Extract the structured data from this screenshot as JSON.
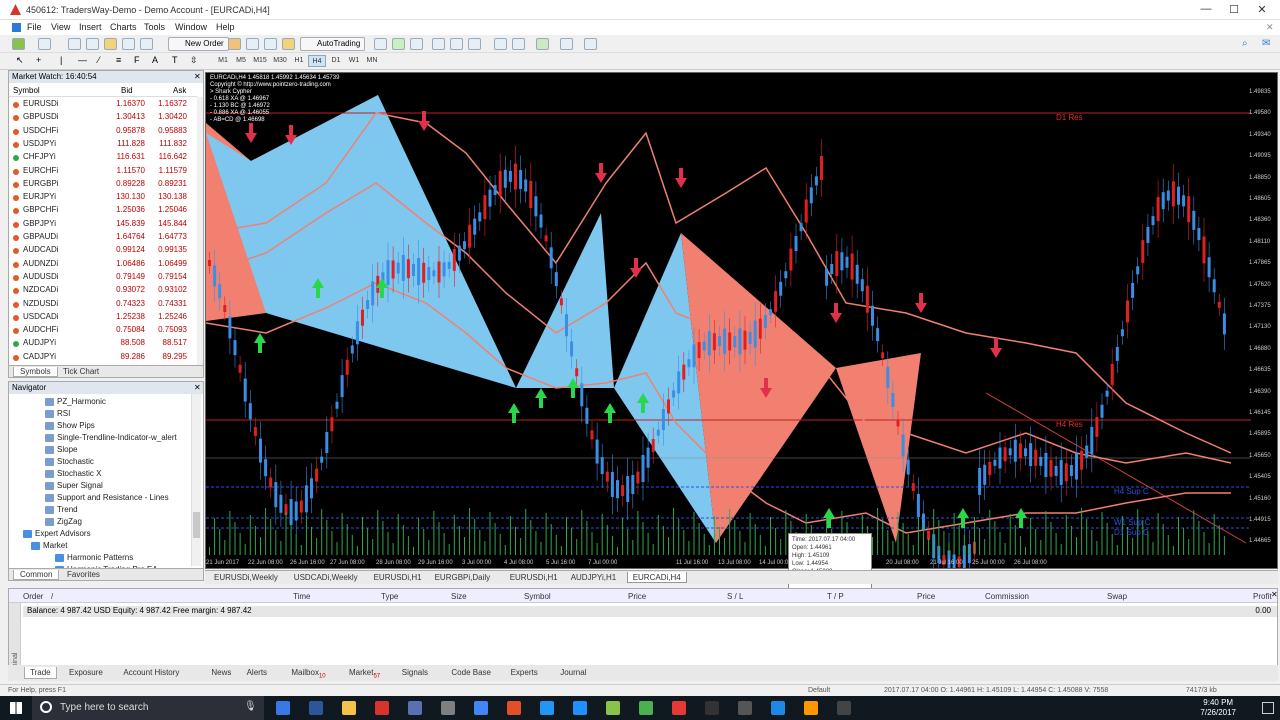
{
  "window": {
    "title": "450612: TradersWay-Demo - Demo Account - [EURCADi,H4]",
    "minimize": "—",
    "maximize": "☐",
    "close": "✕"
  },
  "menu": [
    "File",
    "View",
    "Insert",
    "Charts",
    "Tools",
    "Window",
    "Help"
  ],
  "toolbar": {
    "new_order": "New Order",
    "autotrading": "AutoTrading",
    "timeframes": [
      "M1",
      "M5",
      "M15",
      "M30",
      "H1",
      "H4",
      "D1",
      "W1",
      "MN"
    ]
  },
  "market_watch": {
    "title": "Market Watch: 16:40:54",
    "col_symbol": "Symbol",
    "col_bid": "Bid",
    "col_ask": "Ask",
    "rows": [
      {
        "s": "EURUSDi",
        "b": "1.16370",
        "a": "1.16372",
        "c": "#e05a2a"
      },
      {
        "s": "GBPUSDi",
        "b": "1.30413",
        "a": "1.30420",
        "c": "#e05a2a"
      },
      {
        "s": "USDCHFi",
        "b": "0.95878",
        "a": "0.95883",
        "c": "#e05a2a"
      },
      {
        "s": "USDJPYi",
        "b": "111.828",
        "a": "111.832",
        "c": "#e05a2a"
      },
      {
        "s": "CHFJPYi",
        "b": "116.631",
        "a": "116.642",
        "c": "#2ea84a"
      },
      {
        "s": "EURCHFi",
        "b": "1.11570",
        "a": "1.11579",
        "c": "#e05a2a"
      },
      {
        "s": "EURGBPi",
        "b": "0.89228",
        "a": "0.89231",
        "c": "#e05a2a"
      },
      {
        "s": "EURJPYi",
        "b": "130.130",
        "a": "130.138",
        "c": "#e05a2a"
      },
      {
        "s": "GBPCHFi",
        "b": "1.25036",
        "a": "1.25046",
        "c": "#e05a2a"
      },
      {
        "s": "GBPJPYi",
        "b": "145.839",
        "a": "145.844",
        "c": "#e05a2a"
      },
      {
        "s": "GBPAUDi",
        "b": "1.64764",
        "a": "1.64773",
        "c": "#e05a2a"
      },
      {
        "s": "AUDCADi",
        "b": "0.99124",
        "a": "0.99135",
        "c": "#e05a2a"
      },
      {
        "s": "AUDNZDi",
        "b": "1.06486",
        "a": "1.06499",
        "c": "#e05a2a"
      },
      {
        "s": "AUDUSDi",
        "b": "0.79149",
        "a": "0.79154",
        "c": "#e05a2a"
      },
      {
        "s": "NZDCADi",
        "b": "0.93072",
        "a": "0.93102",
        "c": "#e05a2a"
      },
      {
        "s": "NZDUSDi",
        "b": "0.74323",
        "a": "0.74331",
        "c": "#e05a2a"
      },
      {
        "s": "USDCADi",
        "b": "1.25238",
        "a": "1.25246",
        "c": "#e05a2a"
      },
      {
        "s": "AUDCHFi",
        "b": "0.75084",
        "a": "0.75093",
        "c": "#e05a2a"
      },
      {
        "s": "AUDJPYi",
        "b": "88.508",
        "a": "88.517",
        "c": "#2ea84a"
      },
      {
        "s": "CADJPYi",
        "b": "89.286",
        "a": "89.295",
        "c": "#e05a2a"
      }
    ],
    "tabs": [
      "Symbols",
      "Tick Chart"
    ]
  },
  "navigator": {
    "title": "Navigator",
    "items": [
      "PZ_Harmonic",
      "RSI",
      "Show Pips",
      "Single-Trendline-Indicator-w_alert",
      "Slope",
      "Stochastic",
      "Stochastic X",
      "Super Signal",
      "Support and Resistance - Lines",
      "Trend",
      "ZigZag",
      "Expert Advisors",
      "Market",
      "Harmonic Patterns",
      "Harmonic Trading Pro EA"
    ],
    "tabs": [
      "Common",
      "Favorites"
    ]
  },
  "chart": {
    "info": [
      "EURCADi,H4  1.45818 1.45992 1.45634 1.45739",
      "Copyright © http://www.pointzero-trading.com",
      "> Shark Cypher",
      "- 0.618 XA @ 1.46967",
      "- 1.130 BC @ 1.46972",
      "- 0.886 XA @ 1.46055",
      "- AB=CD @ 1.46698"
    ],
    "prices": [
      "1.49835",
      "1.49580",
      "1.49340",
      "1.49095",
      "1.48850",
      "1.48605",
      "1.48360",
      "1.48110",
      "1.47865",
      "1.47620",
      "1.47375",
      "1.47130",
      "1.46880",
      "1.46635",
      "1.46390",
      "1.46145",
      "1.45895",
      "1.45650",
      "1.45405",
      "1.45160",
      "1.44915",
      "1.44665"
    ],
    "times": [
      "21 Jun 2017",
      "22 Jun 08:00",
      "26 Jun 16:00",
      "27 Jun 08:00",
      "28 Jun 08:00",
      "29 Jun 16:00",
      "3 Jul 00:00",
      "4 Jul 08:00",
      "5 Jul 16:00",
      "7 Jul 00:00",
      "11 Jul 16:00",
      "13 Jul 08:00",
      "14 Jul 00:00",
      "20 Jul 08:00",
      "21 Jul 16:00",
      "25 Jul 00:00",
      "26 Jul 08:00"
    ],
    "labels": {
      "d1res": "D1 Res",
      "h4res": "H4 Res",
      "h4sup": "H4 Sup C",
      "w1sup": "W1 Sup C",
      "d1sup": "D1 Sup C"
    },
    "tooltip": [
      "Time: 2017.07.17 04:00",
      "Open: 1.44961",
      "High: 1.45109",
      "Low: 1.44954",
      "Close: 1.45088",
      "Volume: 7558"
    ]
  },
  "chart_tabs": [
    "EURUSDi,Weekly",
    "USDCADi,Weekly",
    "EURUSDi,H1",
    "EURGBPi,Daily",
    "EURUSDi,H1",
    "AUDJPYi,H1",
    "EURCADi,H4"
  ],
  "terminal": {
    "cols": [
      "Order",
      "/",
      "Time",
      "Type",
      "Size",
      "Symbol",
      "Price",
      "S / L",
      "T / P",
      "Price",
      "Commission",
      "Swap",
      "Profit"
    ],
    "balance": "Balance: 4 987.42 USD  Equity: 4 987.42  Free margin: 4 987.42",
    "balance_profit": "0.00",
    "tabs": [
      "Trade",
      "Exposure",
      "Account History",
      "News",
      "Alerts",
      "Mailbox",
      "Market",
      "Signals",
      "Code Base",
      "Experts",
      "Journal"
    ],
    "mailbox_count": "10",
    "market_count": "57",
    "side_label": "Terminal"
  },
  "status": {
    "help": "For Help, press F1",
    "profile": "Default",
    "ohlc": "2017.07.17 04:00    O: 1.44961    H: 1.45109    L: 1.44954    C: 1.45088    V: 7558",
    "traffic": "7417/3 kb"
  },
  "taskbar": {
    "search": "Type here to search",
    "time": "9:40 PM",
    "date": "7/26/2017"
  }
}
